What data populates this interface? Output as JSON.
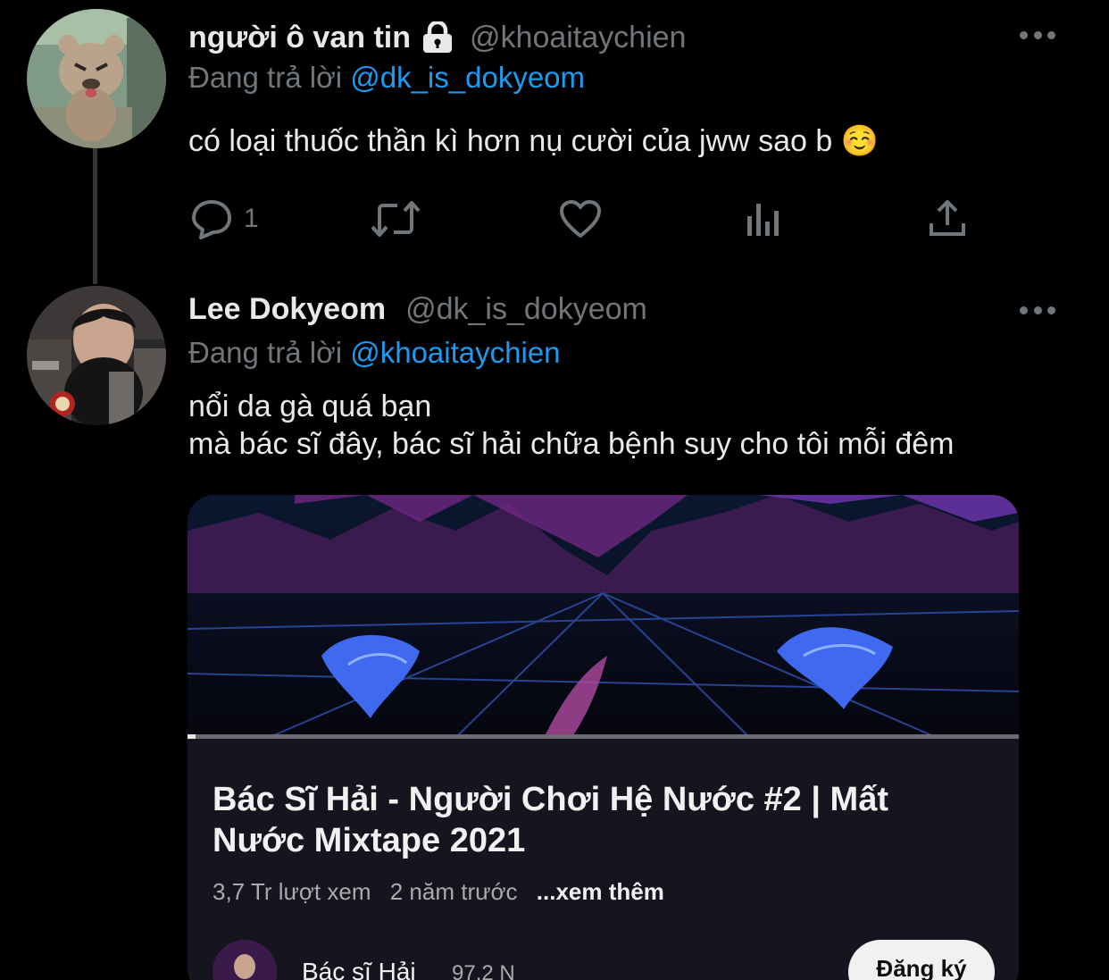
{
  "tweets": [
    {
      "display_name": "người ô van tin",
      "handle": "@khoaitaychien",
      "protected": true,
      "reply_prefix": "Đang trả lời",
      "reply_to": "@dk_is_dokyeom",
      "text": "có loại thuốc thần kì hơn nụ cười của jww sao b ☺️",
      "reply_count": "1"
    },
    {
      "display_name": "Lee Dokyeom",
      "handle": "@dk_is_dokyeom",
      "reply_prefix": "Đang trả lời",
      "reply_to": "@khoaitaychien",
      "text_line1": "nổi da gà quá bạn",
      "text_line2": "mà bác sĩ đây, bác sĩ hải chữa bệnh suy cho tôi mỗi đêm"
    }
  ],
  "media_card": {
    "title": "Bác Sĩ Hải - Người  Chơi  Hệ  Nước #2 | Mất\nNước Mixtape 2021",
    "views": "3,7 Tr lượt xem",
    "age": "2 năm trước",
    "see_more": "...xem thêm",
    "channel_name": "Bác sĩ Hải",
    "channel_subs": "97,2 N",
    "subscribe_label": "Đăng ký",
    "progress": 0.01
  },
  "icons": {
    "lock": "lock-icon",
    "more": "more-icon",
    "reply": "reply-icon",
    "retweet": "retweet-icon",
    "like": "heart-icon",
    "views": "analytics-icon",
    "share": "share-icon"
  },
  "colors": {
    "background": "#000000",
    "text": "#e7e9ea",
    "secondary": "#71767b",
    "link": "#1d9bf0"
  }
}
